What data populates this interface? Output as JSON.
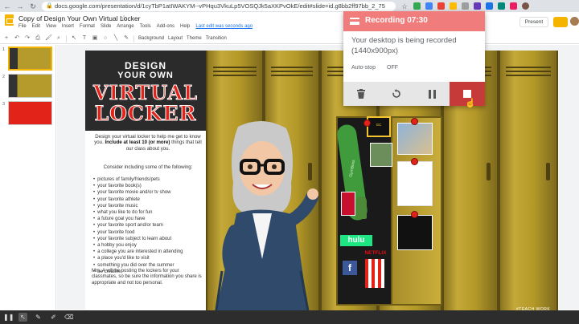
{
  "browser": {
    "url": "docs.google.com/presentation/d/1cyTbP1atIWAKYM--vPHqu3VkuLp5VOSQJk5aXKPvOkE/edit#slide=id.g8bb2ff97bb_2_75"
  },
  "docs": {
    "title": "Copy of Design Your Own Virtual Locker",
    "menu": [
      "File",
      "Edit",
      "View",
      "Insert",
      "Format",
      "Slide",
      "Arrange",
      "Tools",
      "Add-ons",
      "Help"
    ],
    "last_edit": "Last edit was seconds ago",
    "toolbar": {
      "background": "Background",
      "layout": "Layout",
      "theme": "Theme",
      "transition": "Transition"
    },
    "present_label": "Present"
  },
  "filmstrip": {
    "slides": [
      "1",
      "2",
      "3"
    ]
  },
  "slide": {
    "heading": {
      "line1": "DESIGN",
      "line2": "YOUR OWN",
      "line3": "VIRTUAL",
      "line4": "LOCKER"
    },
    "intro_pre": "Design your virtual locker to help me get to know you.",
    "intro_bold": "Include at least 10 (or more)",
    "intro_post": "things that tell our class about you.",
    "consider": "Consider including some of the following:",
    "items": [
      "pictures of family/friends/pets",
      "your favorite book(s)",
      "your favorite movie and/or tv show",
      "your favorite athlete",
      "your favorite music",
      "what you like to do for fun",
      "a future goal you have",
      "your favorite sport and/or team",
      "your favorite food",
      "your favorite subject to learn about",
      "a hobby you enjoy",
      "a college you are interested in attending",
      "a place you'd like to visit",
      "something you did over the summer",
      "be creative!"
    ],
    "closing": "Mrs. A will be posting the lockers for your classmates, so be sure the information you share is appropriate and not too personal.",
    "stickers": {
      "hulu": "hulu",
      "netflix": "NETFLIX",
      "facebook": "f",
      "yoga_mat": "GymBoss",
      "badge": "GC"
    },
    "watermark": "#TEACH WORK"
  },
  "recorder": {
    "title": "Recording 07:30",
    "message": "Your desktop is being recorded (1440x900px)",
    "autostop_label": "Auto-stop",
    "autostop_value": "OFF",
    "header_color": "#f17c7c",
    "stop_color": "#c63a3a"
  }
}
